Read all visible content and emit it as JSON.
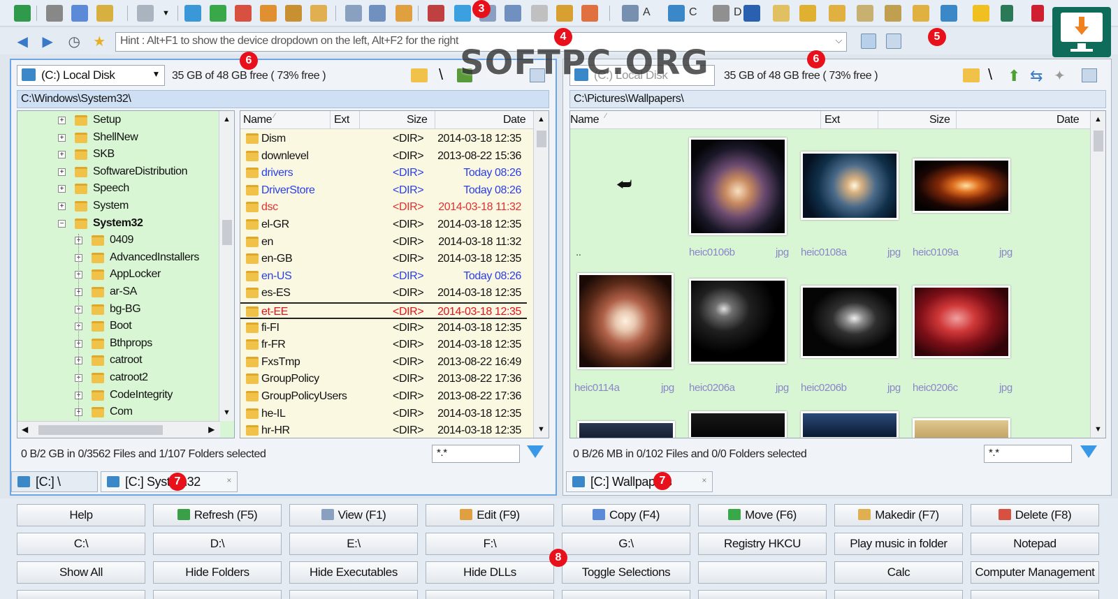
{
  "watermark": "SOFTPC.ORG",
  "toolbar": {
    "drive_labels": [
      "A",
      "C",
      "D"
    ]
  },
  "hint": {
    "text": "Hint : Alt+F1 to show the device dropdown on the left, Alt+F2 for the right"
  },
  "badges": [
    "3",
    "4",
    "5",
    "6",
    "6",
    "7",
    "7",
    "8"
  ],
  "left": {
    "drive": "(C:) Local Disk",
    "free": "35 GB of 48 GB free ( 73% free )",
    "path": "C:\\Windows\\System32\\",
    "tree": [
      {
        "label": "Setup",
        "level": 0
      },
      {
        "label": "ShellNew",
        "level": 0
      },
      {
        "label": "SKB",
        "level": 0
      },
      {
        "label": "SoftwareDistribution",
        "level": 0
      },
      {
        "label": "Speech",
        "level": 0
      },
      {
        "label": "System",
        "level": 0
      },
      {
        "label": "System32",
        "level": 0,
        "expanded": true,
        "bold": true
      },
      {
        "label": "0409",
        "level": 1
      },
      {
        "label": "AdvancedInstallers",
        "level": 1
      },
      {
        "label": "AppLocker",
        "level": 1
      },
      {
        "label": "ar-SA",
        "level": 1
      },
      {
        "label": "bg-BG",
        "level": 1
      },
      {
        "label": "Boot",
        "level": 1
      },
      {
        "label": "Bthprops",
        "level": 1
      },
      {
        "label": "catroot",
        "level": 1
      },
      {
        "label": "catroot2",
        "level": 1
      },
      {
        "label": "CodeIntegrity",
        "level": 1
      },
      {
        "label": "Com",
        "level": 1
      }
    ],
    "columns": {
      "name": "Name",
      "ext": "Ext",
      "size": "Size",
      "date": "Date"
    },
    "files": [
      {
        "name": "Dism",
        "size": "<DIR>",
        "date": "2014-03-18 12:35",
        "color": "#111"
      },
      {
        "name": "downlevel",
        "size": "<DIR>",
        "date": "2013-08-22 15:36",
        "color": "#111"
      },
      {
        "name": "drivers",
        "size": "<DIR>",
        "date": "Today 08:26",
        "color": "#2a3ee8"
      },
      {
        "name": "DriverStore",
        "size": "<DIR>",
        "date": "Today 08:26",
        "color": "#2a3ee8"
      },
      {
        "name": "dsc",
        "size": "<DIR>",
        "date": "2014-03-18 11:32",
        "color": "#e03030"
      },
      {
        "name": "el-GR",
        "size": "<DIR>",
        "date": "2014-03-18 12:35",
        "color": "#111"
      },
      {
        "name": "en",
        "size": "<DIR>",
        "date": "2014-03-18 11:32",
        "color": "#111"
      },
      {
        "name": "en-GB",
        "size": "<DIR>",
        "date": "2014-03-18 12:35",
        "color": "#111"
      },
      {
        "name": "en-US",
        "size": "<DIR>",
        "date": "Today 08:26",
        "color": "#2a3ee8"
      },
      {
        "name": "es-ES",
        "size": "<DIR>",
        "date": "2014-03-18 12:35",
        "color": "#111"
      },
      {
        "name": "et-EE",
        "size": "<DIR>",
        "date": "2014-03-18 12:35",
        "color": "#e8101a",
        "focused": true
      },
      {
        "name": "fi-FI",
        "size": "<DIR>",
        "date": "2014-03-18 12:35",
        "color": "#111"
      },
      {
        "name": "fr-FR",
        "size": "<DIR>",
        "date": "2014-03-18 12:35",
        "color": "#111"
      },
      {
        "name": "FxsTmp",
        "size": "<DIR>",
        "date": "2013-08-22 16:49",
        "color": "#111"
      },
      {
        "name": "GroupPolicy",
        "size": "<DIR>",
        "date": "2013-08-22 17:36",
        "color": "#111"
      },
      {
        "name": "GroupPolicyUsers",
        "size": "<DIR>",
        "date": "2013-08-22 17:36",
        "color": "#111"
      },
      {
        "name": "he-IL",
        "size": "<DIR>",
        "date": "2014-03-18 12:35",
        "color": "#111"
      },
      {
        "name": "hr-HR",
        "size": "<DIR>",
        "date": "2014-03-18 12:35",
        "color": "#111"
      }
    ],
    "status": "0 B/2 GB in 0/3562 Files and 1/107 Folders selected",
    "filter": "*.*",
    "tabs": [
      "[C:] \\",
      "[C:] System32"
    ]
  },
  "right": {
    "drive": "(C:) Local Disk",
    "free": "35 GB of 48 GB free ( 73% free )",
    "path": "C:\\Pictures\\Wallpapers\\",
    "columns": {
      "name": "Name",
      "ext": "Ext",
      "size": "Size",
      "date": "Date"
    },
    "parent_label": "..",
    "thumbs": [
      {
        "name": "heic0106b",
        "ext": "jpg",
        "fill": "radial-gradient(circle at 50% 55%,#f8e0c0 0%,#c88a60 18%,#6a4a70 38%,#1a1828 62%,#050508 80%)"
      },
      {
        "name": "heic0108a",
        "ext": "jpg",
        "fill": "radial-gradient(circle at 55% 50%,#fff8e0 0%,#d8b080 12%,#4a6a8a 35%,#10304a 60%,#051020 85%)"
      },
      {
        "name": "heic0109a",
        "ext": "jpg",
        "fill": "radial-gradient(ellipse at 55% 50%,#ffe0a0 0%,#e07020 18%,#802808 38%,#180604 65%,#050202 85%)"
      },
      {
        "name": "heic0114a",
        "ext": "jpg",
        "fill": "radial-gradient(circle at 50% 50%,#fff0e0 0%,#e8c8b0 15%,#b06048 35%,#5a2a18 60%,#1a0a06 85%)"
      },
      {
        "name": "heic0206a",
        "ext": "jpg",
        "fill": "radial-gradient(ellipse at 35% 35%,#e0e0e0 0%,#707070 10%,#202020 30%,#000 60%)"
      },
      {
        "name": "heic0206b",
        "ext": "jpg",
        "fill": "radial-gradient(ellipse at 55% 45%,#f0f0f0 0%,#909090 12%,#303030 30%,#050505 60%)"
      },
      {
        "name": "heic0206c",
        "ext": "jpg",
        "fill": "radial-gradient(ellipse at 45% 45%,#f0a0a0 0%,#d03838 25%,#801018 50%,#300408 80%)"
      }
    ],
    "status": "0 B/26 MB in 0/102 Files and 0/0 Folders selected",
    "filter": "*.*",
    "tabs": [
      "[C:] Wallpapers"
    ]
  },
  "buttons": [
    [
      "Help",
      "Refresh (F5)",
      "View (F1)",
      "Edit (F9)",
      "Copy (F4)",
      "Move (F6)",
      "Makedir (F7)",
      "Delete (F8)"
    ],
    [
      "C:\\",
      "D:\\",
      "E:\\",
      "F:\\",
      "G:\\",
      "Registry HKCU",
      "Play music in folder",
      "Notepad"
    ],
    [
      "Show All",
      "Hide Folders",
      "Hide Executables",
      "Hide DLLs",
      "Toggle Selections",
      "",
      "Calc",
      "Computer Management"
    ]
  ]
}
